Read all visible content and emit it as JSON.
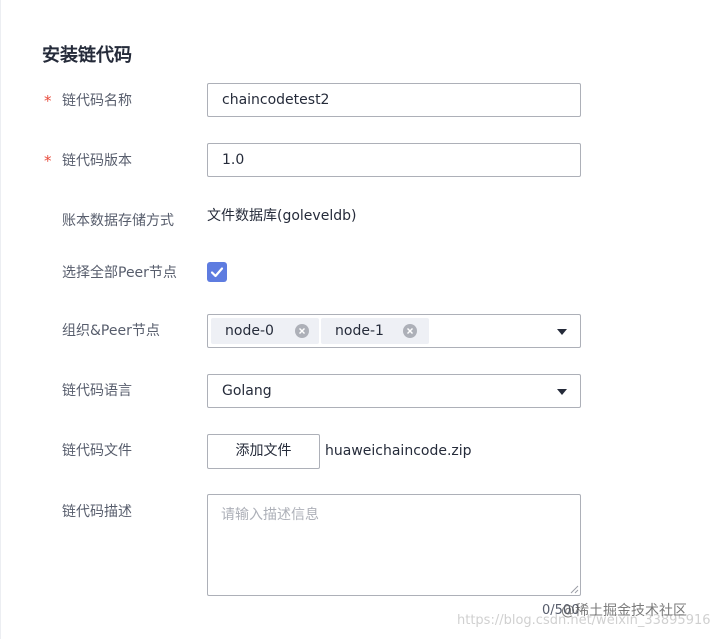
{
  "form": {
    "title": "安装链代码",
    "required_mark": "*",
    "name": {
      "label": "链代码名称",
      "value": "chaincodetest2"
    },
    "version": {
      "label": "链代码版本",
      "value": "1.0"
    },
    "storage": {
      "label": "账本数据存储方式",
      "value": "文件数据库(goleveldb)"
    },
    "select_all_peers": {
      "label": "选择全部Peer节点",
      "checked": true
    },
    "org_peer": {
      "label": "组织&Peer节点",
      "tags": [
        "node-0",
        "node-1"
      ]
    },
    "language": {
      "label": "链代码语言",
      "value": "Golang"
    },
    "file": {
      "label": "链代码文件",
      "button_label": "添加文件",
      "filename": "huaweichaincode.zip"
    },
    "description": {
      "label": "链代码描述",
      "placeholder": "请输入描述信息",
      "counter": "0/500"
    }
  },
  "watermark": {
    "url_text": "https://blog.csdn.net/weixin_33895916",
    "brand_text": "@稀土掘金技术社区"
  },
  "colors": {
    "accent": "#5e7ce0",
    "required": "#e84c3d",
    "border": "#adb0b8"
  }
}
